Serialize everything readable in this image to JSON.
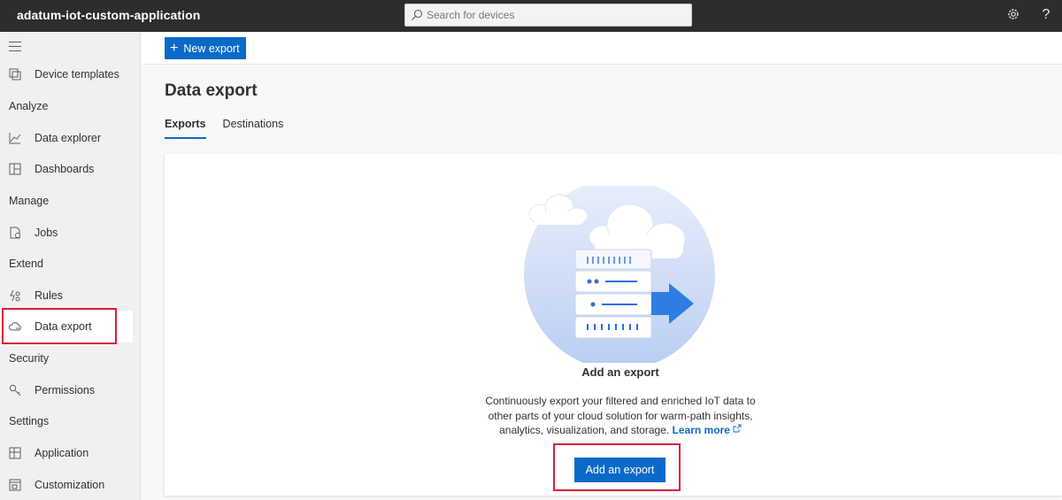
{
  "app": {
    "title": "adatum-iot-custom-application"
  },
  "search": {
    "placeholder": "Search for devices"
  },
  "topbar": {
    "settings_icon": "gear-icon",
    "help_icon": "help-icon",
    "help_glyph": "?"
  },
  "sidebar": {
    "items": [
      {
        "label": "Device templates",
        "icon": "device-templates-icon"
      },
      {
        "section": "Analyze"
      },
      {
        "label": "Data explorer",
        "icon": "chart-line-icon"
      },
      {
        "label": "Dashboards",
        "icon": "dashboard-icon"
      },
      {
        "section": "Manage"
      },
      {
        "label": "Jobs",
        "icon": "jobs-icon"
      },
      {
        "section": "Extend"
      },
      {
        "label": "Rules",
        "icon": "rules-icon"
      },
      {
        "label": "Data export",
        "icon": "cloud-export-icon",
        "active": true
      },
      {
        "section": "Security"
      },
      {
        "label": "Permissions",
        "icon": "key-icon"
      },
      {
        "section": "Settings"
      },
      {
        "label": "Application",
        "icon": "application-icon"
      },
      {
        "label": "Customization",
        "icon": "customization-icon"
      }
    ]
  },
  "toolbar": {
    "new_export_label": "New export"
  },
  "page": {
    "title": "Data export",
    "tabs": [
      {
        "label": "Exports",
        "active": true
      },
      {
        "label": "Destinations",
        "active": false
      }
    ]
  },
  "empty_state": {
    "title": "Add an export",
    "description": "Continuously export your filtered and enriched IoT data to other parts of your cloud solution for warm-path insights, analytics, visualization, and storage.",
    "learn_more": "Learn more",
    "button_label": "Add an export"
  },
  "colors": {
    "accent": "#0a6ac9",
    "highlight": "#d71e3a",
    "topbar": "#2d2d2d"
  }
}
